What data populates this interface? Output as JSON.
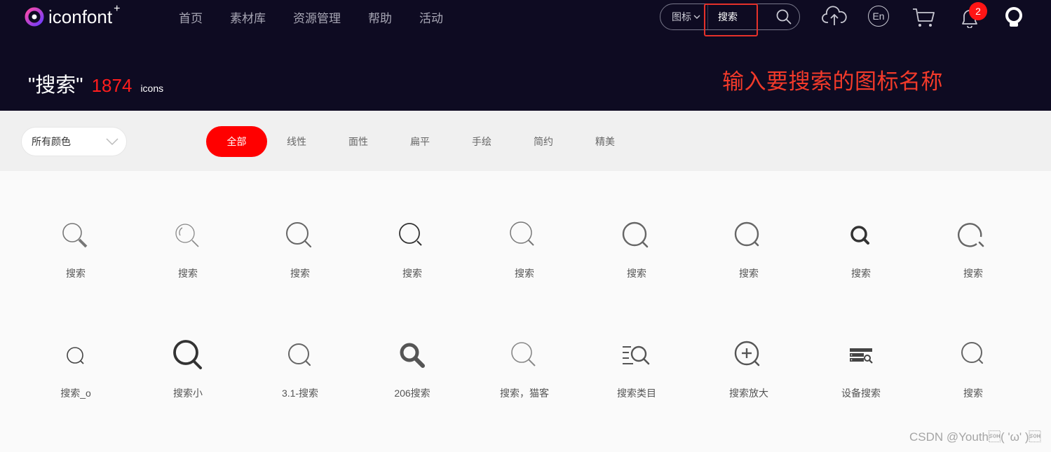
{
  "brand": {
    "name": "iconfont",
    "plus": "+"
  },
  "nav": [
    "首页",
    "素材库",
    "资源管理",
    "帮助",
    "活动"
  ],
  "search": {
    "type_label": "图标",
    "value": "搜索"
  },
  "notifications": {
    "count": "2"
  },
  "lang_label": "En",
  "result": {
    "query": "\"搜索\"",
    "count": "1874",
    "unit": "icons"
  },
  "annotation": "输入要搜索的图标名称",
  "filter": {
    "color_label": "所有颜色",
    "tabs": [
      {
        "label": "全部",
        "active": true
      },
      {
        "label": "线性"
      },
      {
        "label": "面性"
      },
      {
        "label": "扁平"
      },
      {
        "label": "手绘"
      },
      {
        "label": "简约"
      },
      {
        "label": "精美"
      }
    ]
  },
  "icons": [
    {
      "label": "搜索",
      "icon": "search-icon"
    },
    {
      "label": "搜索",
      "icon": "search-icon"
    },
    {
      "label": "搜索",
      "icon": "search-icon"
    },
    {
      "label": "搜索",
      "icon": "search-icon"
    },
    {
      "label": "搜索",
      "icon": "search-icon"
    },
    {
      "label": "搜索",
      "icon": "search-icon"
    },
    {
      "label": "搜索",
      "icon": "search-icon"
    },
    {
      "label": "搜索",
      "icon": "search-icon"
    },
    {
      "label": "搜索",
      "icon": "search-icon"
    },
    {
      "label": "搜索_o",
      "icon": "search-icon"
    },
    {
      "label": "搜索小",
      "icon": "search-icon"
    },
    {
      "label": "3.1-搜索",
      "icon": "search-icon"
    },
    {
      "label": "206搜索",
      "icon": "search-icon"
    },
    {
      "label": "搜索，猫客",
      "icon": "search-icon"
    },
    {
      "label": "搜索类目",
      "icon": "search-category-icon"
    },
    {
      "label": "搜索放大",
      "icon": "zoom-in-icon"
    },
    {
      "label": "设备搜索",
      "icon": "device-search-icon"
    },
    {
      "label": "搜索",
      "icon": "search-icon"
    }
  ],
  "watermark": "CSDN @Youth\u0001( 'ω' )\u0001"
}
